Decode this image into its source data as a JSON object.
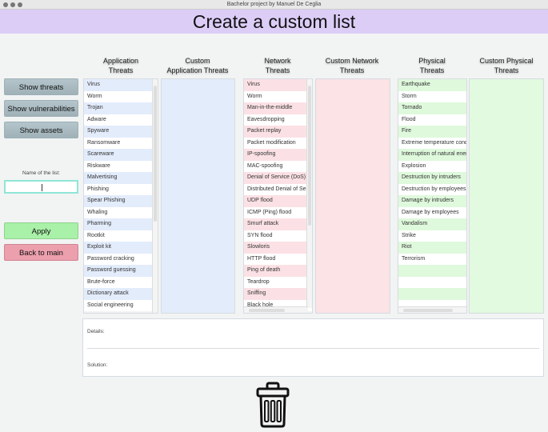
{
  "window": {
    "title": "Bachelor project by Manuel De Ceglia"
  },
  "header": {
    "title": "Create a custom list"
  },
  "sidebar": {
    "show_threats": "Show threats",
    "show_vulnerabilities": "Show vulnerabilities",
    "show_assets": "Show assets",
    "name_label": "Name of the list:",
    "name_value": "",
    "apply": "Apply",
    "back": "Back to main"
  },
  "columns": {
    "app": {
      "line1": "Application",
      "line2": "Threats",
      "color": "#e3ecfb"
    },
    "custom_app": {
      "line1": "Custom",
      "line2": "Application Threats",
      "color": "#e3ecfb"
    },
    "net": {
      "line1": "Network",
      "line2": "Threats",
      "color": "#fbe1e5"
    },
    "custom_net": {
      "line1": "Custom Network",
      "line2": "Threats",
      "color": "#fbe3e6"
    },
    "phys": {
      "line1": "Physical",
      "line2": "Threats",
      "color": "#dff9dc"
    },
    "custom_phys": {
      "line1": "Custom Physical",
      "line2": "Threats",
      "color": "#e2fadf"
    }
  },
  "lists": {
    "app": [
      "Virus",
      "Worm",
      "Trojan",
      "Adware",
      "Spyware",
      "Ransomware",
      "Scareware",
      "Riskware",
      "Malvertising",
      "Phishing",
      "Spear Phishing",
      "Whaling",
      "Pharming",
      "Rootkit",
      "Exploit kit",
      "Password cracking",
      "Password guessing",
      "Brute-force",
      "Dictionary attack",
      "Social engineering"
    ],
    "net": [
      "Virus",
      "Worm",
      "Man-in-the-middle",
      "Eavesdropping",
      "Packet replay",
      "Packet modification",
      "IP-spoofing",
      "MAC-spoofing",
      "Denial of Service (DoS)",
      "Distributed Denial of Service",
      "UDP flood",
      "ICMP (Ping) flood",
      "Smurf attack",
      "SYN flood",
      "Slowloris",
      "HTTP flood",
      "Ping of death",
      "Teardrop",
      "Sniffing",
      "Black hole"
    ],
    "phys": [
      "Earthquake",
      "Storm",
      "Tornado",
      "Flood",
      "Fire",
      "Extreme temperature conditions",
      "Interruption of natural energy",
      "Explosion",
      "Destruction by intruders",
      "Destruction by employees",
      "Damage by intruders",
      "Damage by employees",
      "Vandalism",
      "Strike",
      "Riot",
      "Terrorism",
      "",
      "",
      "",
      ""
    ]
  },
  "details": {
    "details_label": "Details:",
    "solution_label": "Solution:"
  },
  "icons": {
    "trash": "trash-icon"
  }
}
